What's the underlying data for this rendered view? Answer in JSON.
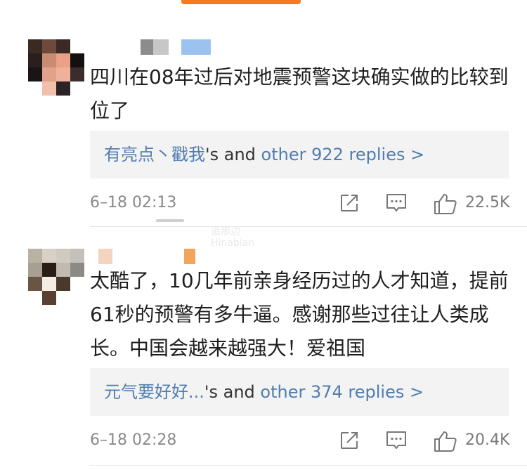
{
  "comments": [
    {
      "text": "四川在08年过后对地震预警这块确实做的比较到位了",
      "replies": {
        "names": "有亮点丶戳我",
        "suffix": "'s and ",
        "count_text": "other 922 replies >"
      },
      "timestamp": "6–18 02:13",
      "likes": "22.5K"
    },
    {
      "text": "太酷了，10几年前亲身经历过的人才知道，提前61秒的预警有多牛逼。感谢那些过往让人类成长。中国会越来越强大！爱祖国",
      "replies": {
        "names": "元气要好好...",
        "suffix": "'s and ",
        "count_text": "other 374 replies >"
      },
      "timestamp": "6–18 02:28",
      "likes": "20.4K"
    }
  ],
  "watermark": {
    "line1": "追那边",
    "line2": "Hinabian"
  },
  "colors": {
    "accent": "#f47b20",
    "link_blue": "#507daf",
    "reply_bg": "#f3f3f3",
    "meta_grey": "#8a8a8a"
  },
  "icons": [
    "share-icon",
    "comment-icon",
    "like-icon"
  ]
}
